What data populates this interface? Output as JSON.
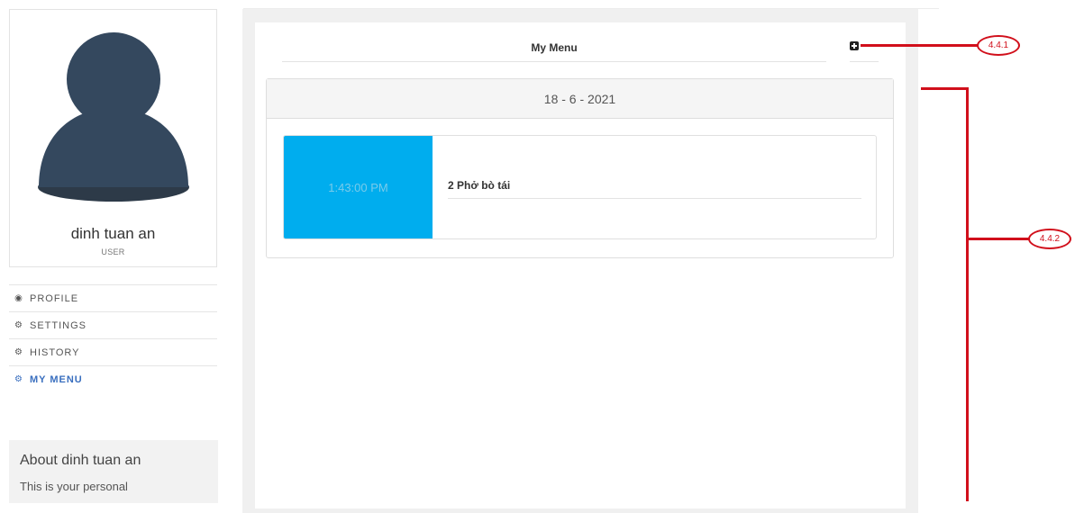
{
  "user": {
    "name": "dinh tuan an",
    "role": "USER"
  },
  "nav": [
    {
      "label": "PROFILE",
      "icon": "eye-icon",
      "active": false
    },
    {
      "label": "SETTINGS",
      "icon": "cogs-icon",
      "active": false
    },
    {
      "label": "HISTORY",
      "icon": "cogs-icon",
      "active": false
    },
    {
      "label": "MY MENU",
      "icon": "cogs-icon",
      "active": true
    }
  ],
  "about": {
    "title": "About dinh tuan an",
    "text": "This is your personal"
  },
  "menu": {
    "title": "My Menu",
    "date": "18 - 6 - 2021",
    "order": {
      "time": "1:43:00 PM",
      "item": "2 Phở bò tái"
    }
  },
  "annotations": {
    "add": "4.4.1",
    "list": "4.4.2"
  },
  "colors": {
    "accent": "#00adee",
    "annotation": "#d10f1b",
    "active_nav": "#3a6fbf"
  }
}
